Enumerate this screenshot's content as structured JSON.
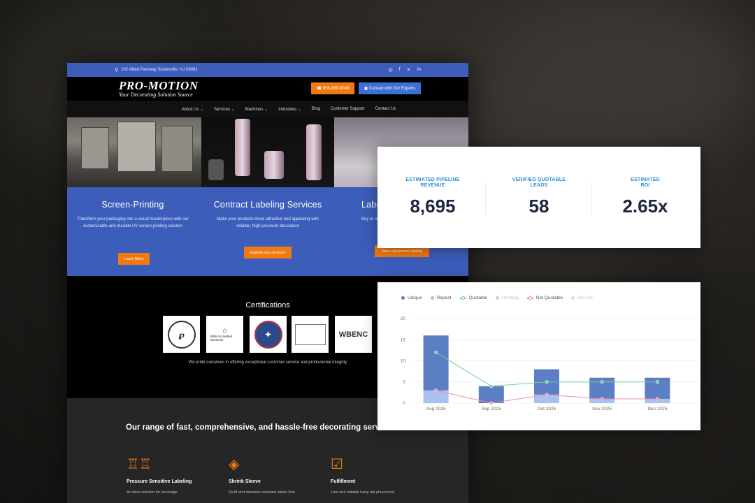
{
  "website": {
    "topbar": {
      "address": "102 Allied Parkway Sicklerville, NJ 08081",
      "social": [
        "instagram-icon",
        "facebook-icon",
        "x-icon",
        "linkedin-icon"
      ]
    },
    "logo": {
      "name": "PRO-MOTION",
      "tagline": "Your Decorating Solution Source"
    },
    "header": {
      "phone": "856-889-6049",
      "consult": "Consult with Our Experts"
    },
    "nav": [
      "About Us",
      "Services",
      "Machines",
      "Industries",
      "Blog",
      "Customer Support",
      "Contact Us"
    ],
    "services": [
      {
        "title": "Screen-Printing",
        "desc": "Transform your packaging into a visual masterpiece with our customizable and durable UV screen-printing solution",
        "button": "Learn More"
      },
      {
        "title": "Contract Labeling Services",
        "desc": "Make your products more attractive and appealing with reliable, high-precision decoration",
        "button": "Explore our services"
      },
      {
        "title": "Labe",
        "desc": "Buy or rent a labeling",
        "button": "View equipment catalog"
      }
    ],
    "certifications": {
      "title": "Certifications",
      "tagline": "We pride ourselves in offering exceptional customer service and professional integrity",
      "badges": [
        "BBB Accredited Business",
        "WBENC"
      ]
    },
    "range": {
      "title": "Our range of fast, comprehensive, and hassle-free decorating services include:",
      "items": [
        {
          "title": "Pressure Sensitive Labeling",
          "desc": "An ideal solution for beverage"
        },
        {
          "title": "Shrink Sleeve",
          "desc": "Scuff and moisture resistant labels that"
        },
        {
          "title": "Fulfillment",
          "desc": "Fast and reliable hang tab placement,"
        }
      ]
    }
  },
  "kpis": [
    {
      "label1": "ESTIMATED PIPELINE",
      "label2": "REVENUE",
      "value": "8,695"
    },
    {
      "label1": "VERIFIED QUOTABLE",
      "label2": "LEADS",
      "value": "58"
    },
    {
      "label1": "ESTIMATED",
      "label2": "ROI",
      "value": "2.65x"
    }
  ],
  "chart_data": {
    "type": "bar",
    "categories": [
      "Aug 2025",
      "Sep 2025",
      "Oct 2025",
      "Nov 2025",
      "Dec 2025"
    ],
    "ylim": [
      0,
      20
    ],
    "yticks": [
      0,
      5,
      10,
      15,
      20
    ],
    "legend": [
      "Unique",
      "Repeat",
      "Quotable",
      "Pending",
      "Not Quotable",
      "Not Set"
    ],
    "series": [
      {
        "name": "Unique",
        "type": "bar",
        "color": "#5b7ec4",
        "values": [
          13,
          4,
          6,
          5,
          5
        ]
      },
      {
        "name": "Repeat",
        "type": "bar",
        "color": "#a9c1ee",
        "values": [
          3,
          0,
          2,
          1,
          1
        ]
      },
      {
        "name": "Quotable",
        "type": "line",
        "color": "#6ccf9a",
        "values": [
          12,
          4,
          5,
          5,
          5
        ]
      },
      {
        "name": "Not Quotable",
        "type": "line",
        "color": "#f18aa8",
        "values": [
          3,
          0,
          2,
          1,
          1
        ]
      }
    ],
    "legend_colors": {
      "Unique": "#5b7ec4",
      "Repeat": "#a9c1ee",
      "Quotable": "#6ccf9a",
      "Pending": "#c9d0dc",
      "Not Quotable": "#f18aa8",
      "Not Set": "#d6dae2"
    }
  }
}
